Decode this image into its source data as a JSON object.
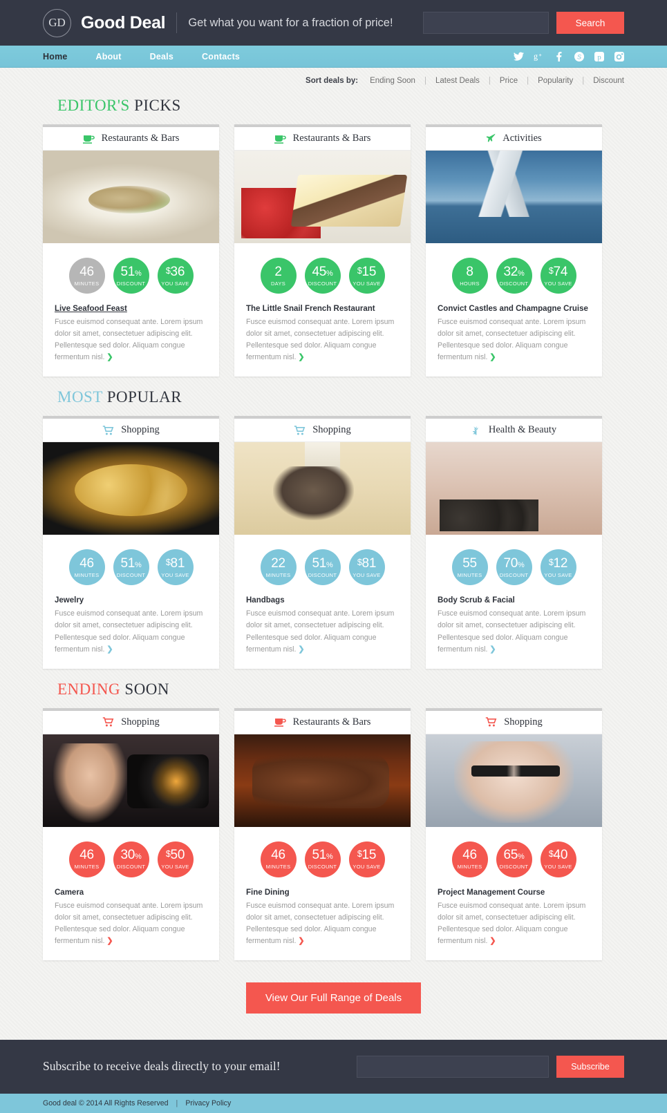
{
  "header": {
    "logo_mark": "GD",
    "logo_text": "Good Deal",
    "tagline": "Get what you want for a fraction of price!",
    "search_value": "",
    "search_placeholder": "",
    "search_button": "Search"
  },
  "nav": {
    "items": [
      {
        "label": "Home",
        "active": true
      },
      {
        "label": "About",
        "active": false
      },
      {
        "label": "Deals",
        "active": false
      },
      {
        "label": "Contacts",
        "active": false
      }
    ],
    "socials": [
      "twitter-icon",
      "google-plus-icon",
      "facebook-icon",
      "skype-icon",
      "pinterest-icon",
      "instagram-icon"
    ]
  },
  "sort": {
    "label": "Sort deals by:",
    "options": [
      "Ending Soon",
      "Latest Deals",
      "Price",
      "Popularity",
      "Discount"
    ],
    "separator": "|"
  },
  "sections": [
    {
      "title_accent": "EDITOR'S",
      "title_rest": "PICKS",
      "accent_color": "#3ac569",
      "accent_class": "accent-green",
      "badge_color": "#3ac569",
      "icon_color": "#3ac569",
      "chevron_color": "#3ac569",
      "cards": [
        {
          "category": "Restaurants & Bars",
          "icon": "coffee-cup-icon",
          "photo": "ph-seafood",
          "title": "Live Seafood Feast",
          "title_underline": true,
          "desc": "Fusce euismod consequat ante. Lorem ipsum dolor sit amet, consectetuer adipiscing elit. Pellentesque sed dolor. Aliquam congue fermentum nisl.",
          "badges": [
            {
              "value": "46",
              "label": "MINUTES",
              "color": "#b6b6b6",
              "prefix": "",
              "suffix": ""
            },
            {
              "value": "51",
              "label": "DISCOUNT",
              "color": "#3ac569",
              "prefix": "",
              "suffix": "%"
            },
            {
              "value": "36",
              "label": "YOU SAVE",
              "color": "#3ac569",
              "prefix": "$",
              "suffix": ""
            }
          ]
        },
        {
          "category": "Restaurants & Bars",
          "icon": "coffee-cup-icon",
          "photo": "ph-cake",
          "title": "The Little Snail French Restaurant",
          "title_underline": false,
          "desc": "Fusce euismod consequat ante. Lorem ipsum dolor sit amet, consectetuer adipiscing elit. Pellentesque sed dolor. Aliquam congue fermentum nisl.",
          "badges": [
            {
              "value": "2",
              "label": "DAYS",
              "color": "#3ac569",
              "prefix": "",
              "suffix": ""
            },
            {
              "value": "45",
              "label": "DISCOUNT",
              "color": "#3ac569",
              "prefix": "",
              "suffix": "%"
            },
            {
              "value": "15",
              "label": "YOU SAVE",
              "color": "#3ac569",
              "prefix": "$",
              "suffix": ""
            }
          ]
        },
        {
          "category": "Activities",
          "icon": "pin-icon",
          "photo": "ph-sail",
          "title": "Convict Castles and Champagne Cruise",
          "title_underline": false,
          "desc": "Fusce euismod consequat ante. Lorem ipsum dolor sit amet, consectetuer adipiscing elit. Pellentesque sed dolor. Aliquam congue fermentum nisl.",
          "badges": [
            {
              "value": "8",
              "label": "HOURS",
              "color": "#3ac569",
              "prefix": "",
              "suffix": ""
            },
            {
              "value": "32",
              "label": "DISCOUNT",
              "color": "#3ac569",
              "prefix": "",
              "suffix": "%"
            },
            {
              "value": "74",
              "label": "YOU SAVE",
              "color": "#3ac569",
              "prefix": "$",
              "suffix": ""
            }
          ]
        }
      ]
    },
    {
      "title_accent": "MOST",
      "title_rest": "POPULAR",
      "accent_color": "#7ec6da",
      "accent_class": "accent-blue",
      "badge_color": "#7ec6da",
      "icon_color": "#7ec6da",
      "chevron_color": "#7ec6da",
      "cards": [
        {
          "category": "Shopping",
          "icon": "shopping-cart-icon",
          "photo": "ph-jewel",
          "title": "Jewelry",
          "title_underline": false,
          "desc": "Fusce euismod consequat ante. Lorem ipsum dolor sit amet, consectetuer adipiscing elit. Pellentesque sed dolor. Aliquam congue fermentum nisl.",
          "badges": [
            {
              "value": "46",
              "label": "MINUTES",
              "color": "#7ec6da",
              "prefix": "",
              "suffix": ""
            },
            {
              "value": "51",
              "label": "DISCOUNT",
              "color": "#7ec6da",
              "prefix": "",
              "suffix": "%"
            },
            {
              "value": "81",
              "label": "YOU SAVE",
              "color": "#7ec6da",
              "prefix": "$",
              "suffix": ""
            }
          ]
        },
        {
          "category": "Shopping",
          "icon": "shopping-cart-icon",
          "photo": "ph-bags",
          "title": "Handbags",
          "title_underline": false,
          "desc": "Fusce euismod consequat ante. Lorem ipsum dolor sit amet, consectetuer adipiscing elit. Pellentesque sed dolor. Aliquam congue fermentum nisl.",
          "badges": [
            {
              "value": "22",
              "label": "MINUTES",
              "color": "#7ec6da",
              "prefix": "",
              "suffix": ""
            },
            {
              "value": "51",
              "label": "DISCOUNT",
              "color": "#7ec6da",
              "prefix": "",
              "suffix": "%"
            },
            {
              "value": "81",
              "label": "YOU SAVE",
              "color": "#7ec6da",
              "prefix": "$",
              "suffix": ""
            }
          ]
        },
        {
          "category": "Health & Beauty",
          "icon": "leaf-icon",
          "photo": "ph-spa",
          "title": "Body Scrub & Facial",
          "title_underline": false,
          "desc": "Fusce euismod consequat ante. Lorem ipsum dolor sit amet, consectetuer adipiscing elit. Pellentesque sed dolor. Aliquam congue fermentum nisl.",
          "badges": [
            {
              "value": "55",
              "label": "MINUTES",
              "color": "#7ec6da",
              "prefix": "",
              "suffix": ""
            },
            {
              "value": "70",
              "label": "DISCOUNT",
              "color": "#7ec6da",
              "prefix": "",
              "suffix": "%"
            },
            {
              "value": "12",
              "label": "YOU SAVE",
              "color": "#7ec6da",
              "prefix": "$",
              "suffix": ""
            }
          ]
        }
      ]
    },
    {
      "title_accent": "ENDING",
      "title_rest": "SOON",
      "accent_color": "#f4574f",
      "accent_class": "accent-red",
      "badge_color": "#f4574f",
      "icon_color": "#f4574f",
      "chevron_color": "#f4574f",
      "cards": [
        {
          "category": "Shopping",
          "icon": "shopping-cart-icon",
          "photo": "ph-camera",
          "title": "Camera",
          "title_underline": false,
          "desc": "Fusce euismod consequat ante. Lorem ipsum dolor sit amet, consectetuer adipiscing elit. Pellentesque sed dolor. Aliquam congue fermentum nisl.",
          "badges": [
            {
              "value": "46",
              "label": "MINUTES",
              "color": "#f4574f",
              "prefix": "",
              "suffix": ""
            },
            {
              "value": "30",
              "label": "DISCOUNT",
              "color": "#f4574f",
              "prefix": "",
              "suffix": "%"
            },
            {
              "value": "50",
              "label": "YOU SAVE",
              "color": "#f4574f",
              "prefix": "$",
              "suffix": ""
            }
          ]
        },
        {
          "category": "Restaurants & Bars",
          "icon": "coffee-cup-icon",
          "photo": "ph-steak",
          "title": "Fine Dining",
          "title_underline": false,
          "desc": "Fusce euismod consequat ante. Lorem ipsum dolor sit amet, consectetuer adipiscing elit. Pellentesque sed dolor. Aliquam congue fermentum nisl.",
          "badges": [
            {
              "value": "46",
              "label": "MINUTES",
              "color": "#f4574f",
              "prefix": "",
              "suffix": ""
            },
            {
              "value": "51",
              "label": "DISCOUNT",
              "color": "#f4574f",
              "prefix": "",
              "suffix": "%"
            },
            {
              "value": "15",
              "label": "YOU SAVE",
              "color": "#f4574f",
              "prefix": "$",
              "suffix": ""
            }
          ]
        },
        {
          "category": "Shopping",
          "icon": "shopping-cart-icon",
          "photo": "ph-glasses",
          "title": "Project Management Course",
          "title_underline": false,
          "desc": "Fusce euismod consequat ante. Lorem ipsum dolor sit amet, consectetuer adipiscing elit. Pellentesque sed dolor. Aliquam congue fermentum nisl.",
          "badges": [
            {
              "value": "46",
              "label": "MINUTES",
              "color": "#f4574f",
              "prefix": "",
              "suffix": ""
            },
            {
              "value": "65",
              "label": "DISCOUNT",
              "color": "#f4574f",
              "prefix": "",
              "suffix": "%"
            },
            {
              "value": "40",
              "label": "YOU SAVE",
              "color": "#f4574f",
              "prefix": "$",
              "suffix": ""
            }
          ]
        }
      ]
    }
  ],
  "cta": {
    "label": "View Our Full Range of Deals"
  },
  "footer": {
    "subscribe_text": "Subscribe to receive deals directly to your email!",
    "subscribe_value": "",
    "subscribe_placeholder": "",
    "subscribe_button": "Subscribe",
    "copyright": "Good deal © 2014 All Rights Reserved",
    "separator": "|",
    "privacy": "Privacy Policy"
  },
  "colors": {
    "dark": "#343845",
    "nav_blue": "#7ec6da",
    "red": "#f4574f",
    "green": "#3ac569",
    "gray_badge": "#b6b6b6"
  }
}
